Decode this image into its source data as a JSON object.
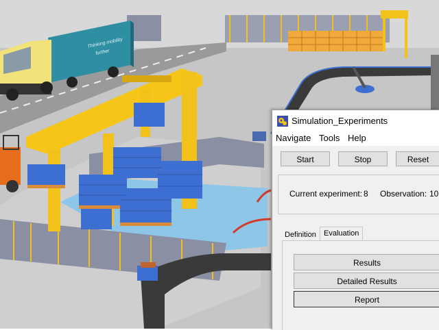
{
  "window": {
    "title": "Simulation_Experiments",
    "icon": "gear-app-icon"
  },
  "menu": [
    "Navigate",
    "Tools",
    "Help"
  ],
  "controls": {
    "start": "Start",
    "stop": "Stop",
    "reset": "Reset"
  },
  "status": {
    "experiment_label": "Current experiment:",
    "experiment_value": "8",
    "observation_label": "Observation:",
    "observation_value": "10"
  },
  "tabs": [
    {
      "label": "Definition",
      "selected": false
    },
    {
      "label": "Evaluation",
      "selected": true
    }
  ],
  "evaluation": {
    "results": "Results",
    "detailed_results": "Detailed Results",
    "report": "Report"
  },
  "truck": {
    "trailer_text_line1": "Thinking mobility",
    "trailer_text_line2": "further"
  },
  "colors": {
    "floor": "#c9c9c9",
    "gantry": "#f5c518",
    "crates": "#3c6fd1",
    "pallets": "#d98c3a",
    "conveyor": "#3a3a3a",
    "truck_cab": "#f2e27a",
    "trailer": "#2e8fa3"
  }
}
